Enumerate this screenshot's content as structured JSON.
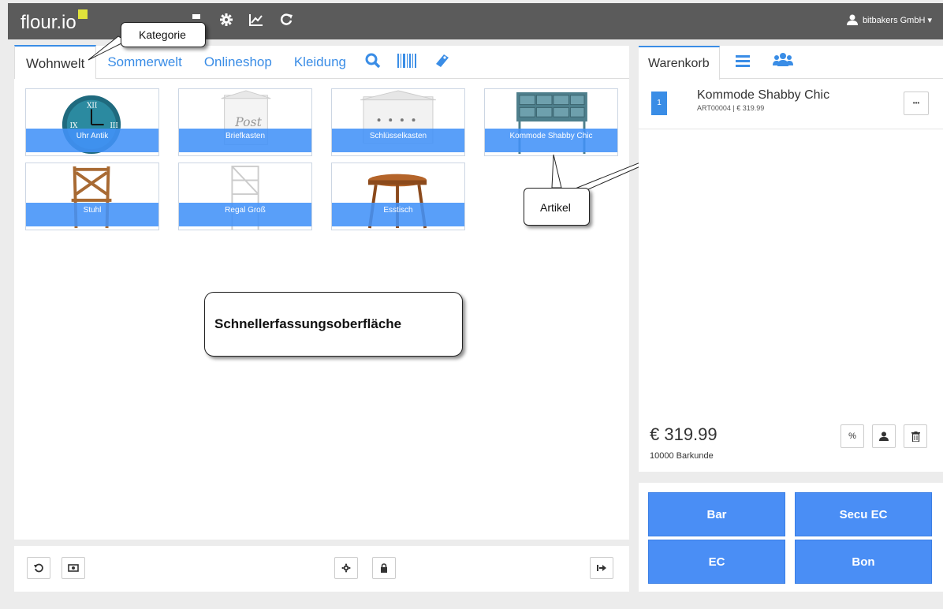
{
  "app": {
    "logo_text": "flour.io",
    "brand_accent": "#e0e33b"
  },
  "topbar": {
    "user": "bitbakers GmbH ▾"
  },
  "tabs": [
    {
      "label": "Wohnwelt"
    },
    {
      "label": "Sommerwelt"
    },
    {
      "label": "Onlineshop"
    },
    {
      "label": "Kleidung"
    }
  ],
  "tiles": [
    {
      "label": "Uhr Antik"
    },
    {
      "label": "Briefkasten"
    },
    {
      "label": "Schlüsselkasten"
    },
    {
      "label": "Kommode Shabby Chic"
    },
    {
      "label": "Stuhl"
    },
    {
      "label": "Regal Groß"
    },
    {
      "label": "Esstisch"
    }
  ],
  "callouts": {
    "kategorie": "Kategorie",
    "artikel": "Artikel",
    "main": "Schnellerfassungsoberfläche"
  },
  "cart": {
    "tab_label": "Warenkorb",
    "item": {
      "qty": "1",
      "name": "Kommode Shabby Chic",
      "meta": "ART00004 | € 319.99",
      "more": "•••"
    },
    "total": "€ 319.99",
    "customer": "10000 Barkunde",
    "discount_label": "%"
  },
  "payments": [
    {
      "label": "Bar"
    },
    {
      "label": "Secu EC"
    },
    {
      "label": "EC"
    },
    {
      "label": "Bon"
    }
  ],
  "colors": {
    "accent": "#3a8de6",
    "tile_label_bg": "#4292f8",
    "pay_button": "#4a8ef5",
    "topbar": "#5b5b5b"
  }
}
